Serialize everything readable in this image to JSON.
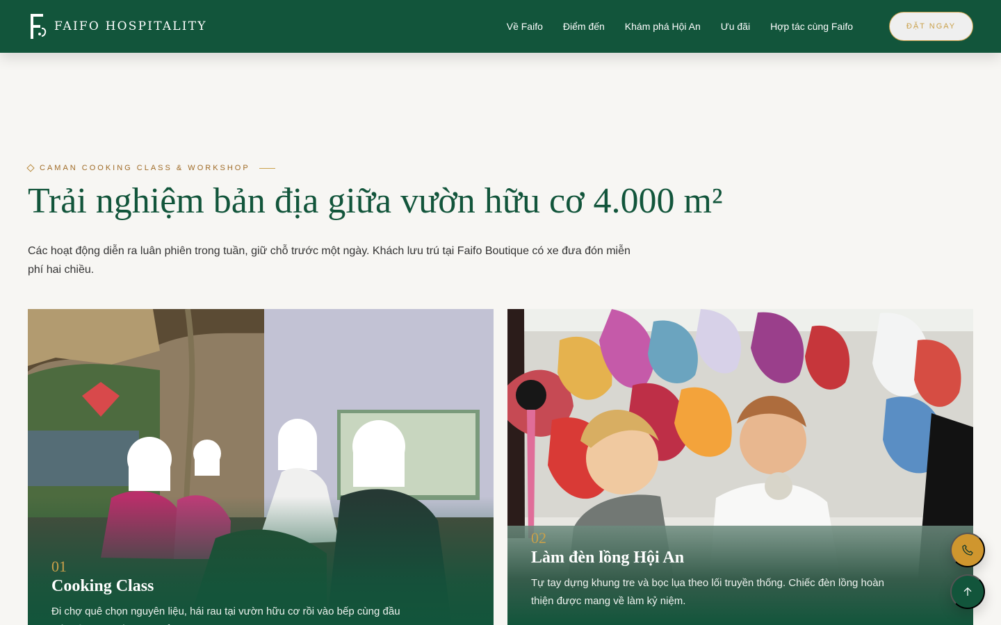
{
  "brand": {
    "name": "FAIFO HOSPITALITY"
  },
  "nav": {
    "items": [
      {
        "label": "Về Faifo"
      },
      {
        "label": "Điểm đến"
      },
      {
        "label": "Khám phá Hội An"
      },
      {
        "label": "Ưu đãi"
      },
      {
        "label": "Hợp tác cùng Faifo"
      }
    ]
  },
  "header": {
    "book_label": "ĐẶT NGAY"
  },
  "section": {
    "eyebrow": "CAMAN COOKING CLASS & WORKSHOP",
    "title": "Trải nghiệm bản địa giữa vườn hữu cơ 4.000 m²",
    "description": "Các hoạt động diễn ra luân phiên trong tuần, giữ chỗ trước một ngày. Khách lưu trú tại Faifo Boutique có xe đưa đón miễn phí hai chiều."
  },
  "cards": [
    {
      "number": "01",
      "title": "Cooking Class",
      "description": "Đi chợ quê chọn nguyên liệu, hái rau tại vườn hữu cơ rồi vào bếp cùng đầu bếp bản địa. Kết thúc buổi học là bữa ăn do chính du khách thực hiện."
    },
    {
      "number": "02",
      "title": "Làm đèn lồng Hội An",
      "description": "Tự tay dựng khung tre và bọc lụa theo lối truyền thống. Chiếc đèn lồng hoàn thiện được mang về làm kỷ niệm."
    }
  ],
  "icons": {
    "phone": "phone-icon",
    "arrow_up": "arrow-up-icon"
  },
  "colors": {
    "brand_green": "#12553b",
    "gold": "#c9a04a",
    "background": "#f7f6f3"
  }
}
